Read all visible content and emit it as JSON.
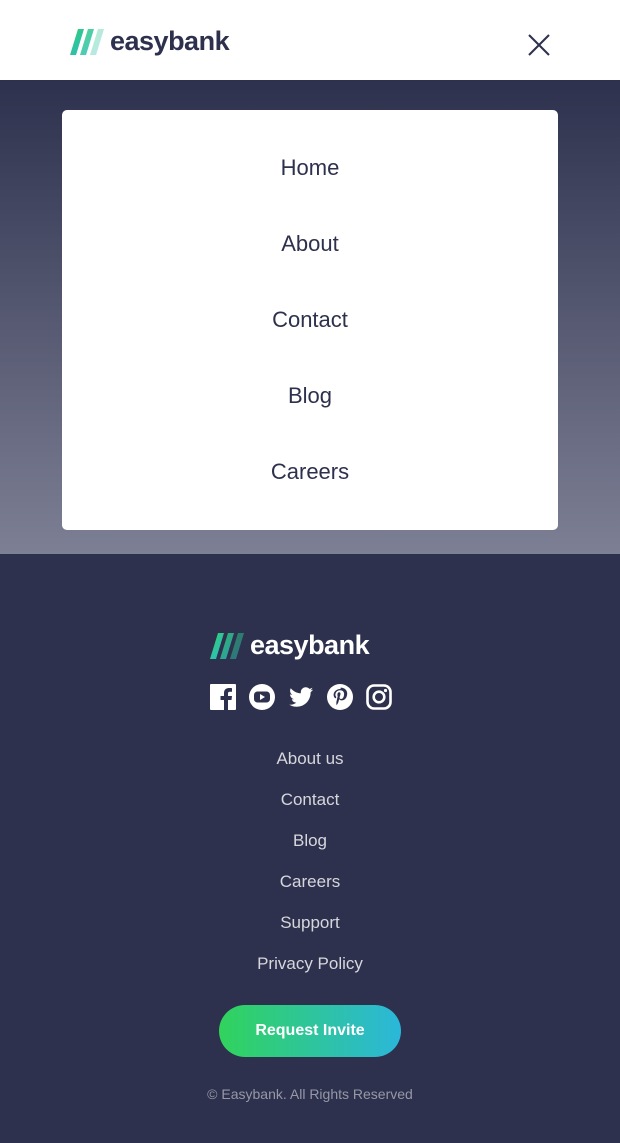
{
  "header": {
    "logo_text": "easybank"
  },
  "menu": {
    "items": [
      {
        "label": "Home"
      },
      {
        "label": "About"
      },
      {
        "label": "Contact"
      },
      {
        "label": "Blog"
      },
      {
        "label": "Careers"
      }
    ]
  },
  "footer": {
    "logo_text": "easybank",
    "social_icons": [
      "facebook-icon",
      "youtube-icon",
      "twitter-icon",
      "pinterest-icon",
      "instagram-icon"
    ],
    "links": [
      {
        "label": "About us"
      },
      {
        "label": "Contact"
      },
      {
        "label": "Blog"
      },
      {
        "label": "Careers"
      },
      {
        "label": "Support"
      },
      {
        "label": "Privacy Policy"
      }
    ],
    "cta_label": "Request Invite",
    "copyright": "© Easybank. All Rights Reserved"
  },
  "colors": {
    "dark_blue": "#2d314d",
    "lime_green": "#31d35c",
    "bright_cyan": "#2bb7da",
    "white": "#ffffff"
  }
}
